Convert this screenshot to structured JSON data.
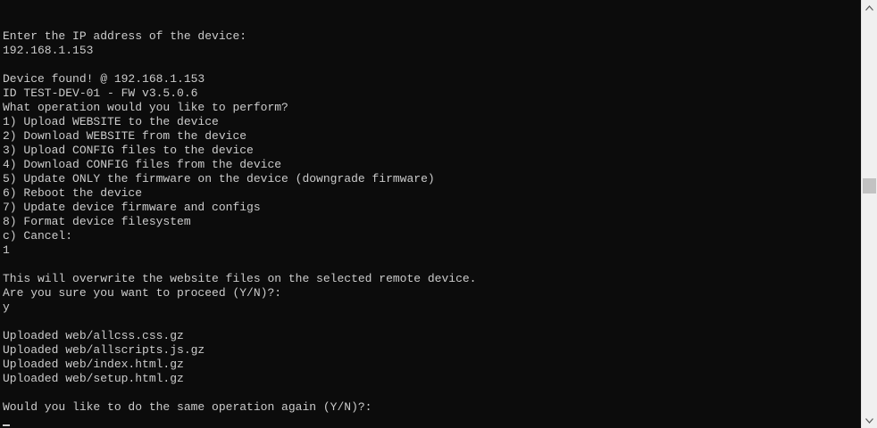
{
  "console": {
    "lines": [
      "Enter the IP address of the device:",
      "192.168.1.153",
      "",
      "Device found! @ 192.168.1.153",
      "ID TEST-DEV-01 - FW v3.5.0.6",
      "What operation would you like to perform?",
      "1) Upload WEBSITE to the device",
      "2) Download WEBSITE from the device",
      "3) Upload CONFIG files to the device",
      "4) Download CONFIG files from the device",
      "5) Update ONLY the firmware on the device (downgrade firmware)",
      "6) Reboot the device",
      "7) Update device firmware and configs",
      "8) Format device filesystem",
      "c) Cancel:",
      "1",
      "",
      "This will overwrite the website files on the selected remote device.",
      "Are you sure you want to proceed (Y/N)?:",
      "y",
      "",
      "Uploaded web/allcss.css.gz",
      "Uploaded web/allscripts.js.gz",
      "Uploaded web/index.html.gz",
      "Uploaded web/setup.html.gz",
      "",
      "Would you like to do the same operation again (Y/N)?:"
    ]
  },
  "scrollbar": {
    "up_icon": "chevron-up-icon",
    "down_icon": "chevron-down-icon"
  },
  "colors": {
    "background": "#0c0c0c",
    "text": "#cccccc",
    "scrollbar": "#f0f0f0",
    "thumb": "#c2c2c2"
  }
}
